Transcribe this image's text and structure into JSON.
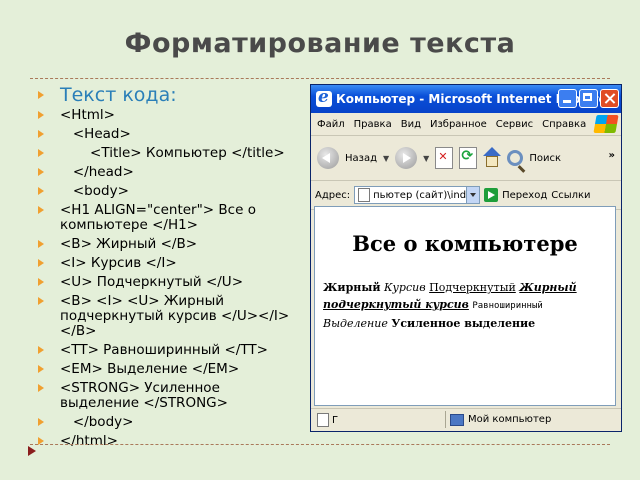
{
  "slide": {
    "title": "Форматирование текста",
    "list_header": "Текст кода:",
    "code_lines": [
      "<Html>",
      "   <Head>",
      "       <Title> Компьютер </title>",
      "   </head>",
      "   <body>",
      "<H1 ALIGN=\"center\"> Все о компьютере </H1>",
      "<B> Жирный </B>",
      "<I> Курсив </I>",
      "<U> Подчеркнутый </U>",
      "<B> <I> <U> Жирный подчеркнутый курсив </U></I></B>",
      "<TT> Равноширинный </TT>",
      "<EM> Выделение </EM>",
      "<STRONG> Усиленное выделение </STRONG>",
      "   </body>",
      "</html>"
    ]
  },
  "browser": {
    "window_title": "Компьютер - Microsoft Internet Explorer",
    "menu": [
      "Файл",
      "Правка",
      "Вид",
      "Избранное",
      "Сервис",
      "Справка"
    ],
    "toolbar": {
      "back": "Назад",
      "search": "Поиск",
      "more": "»"
    },
    "address": {
      "label": "Адрес:",
      "value": "пьютер (сайт)\\index.htm",
      "go": "Переход",
      "links": "Ссылки"
    },
    "page": {
      "heading": "Все о компьютере",
      "bold": "Жирный",
      "italic": "Курсив",
      "underline": "Подчеркнутый",
      "bold_italic_underline": "Жирный подчеркнутый курсив",
      "teletype": "Равноширинный",
      "emphasis": "Выделение",
      "strong": "Усиленное выделение"
    },
    "status": {
      "left": "Г",
      "zone": "Мой компьютер"
    }
  }
}
